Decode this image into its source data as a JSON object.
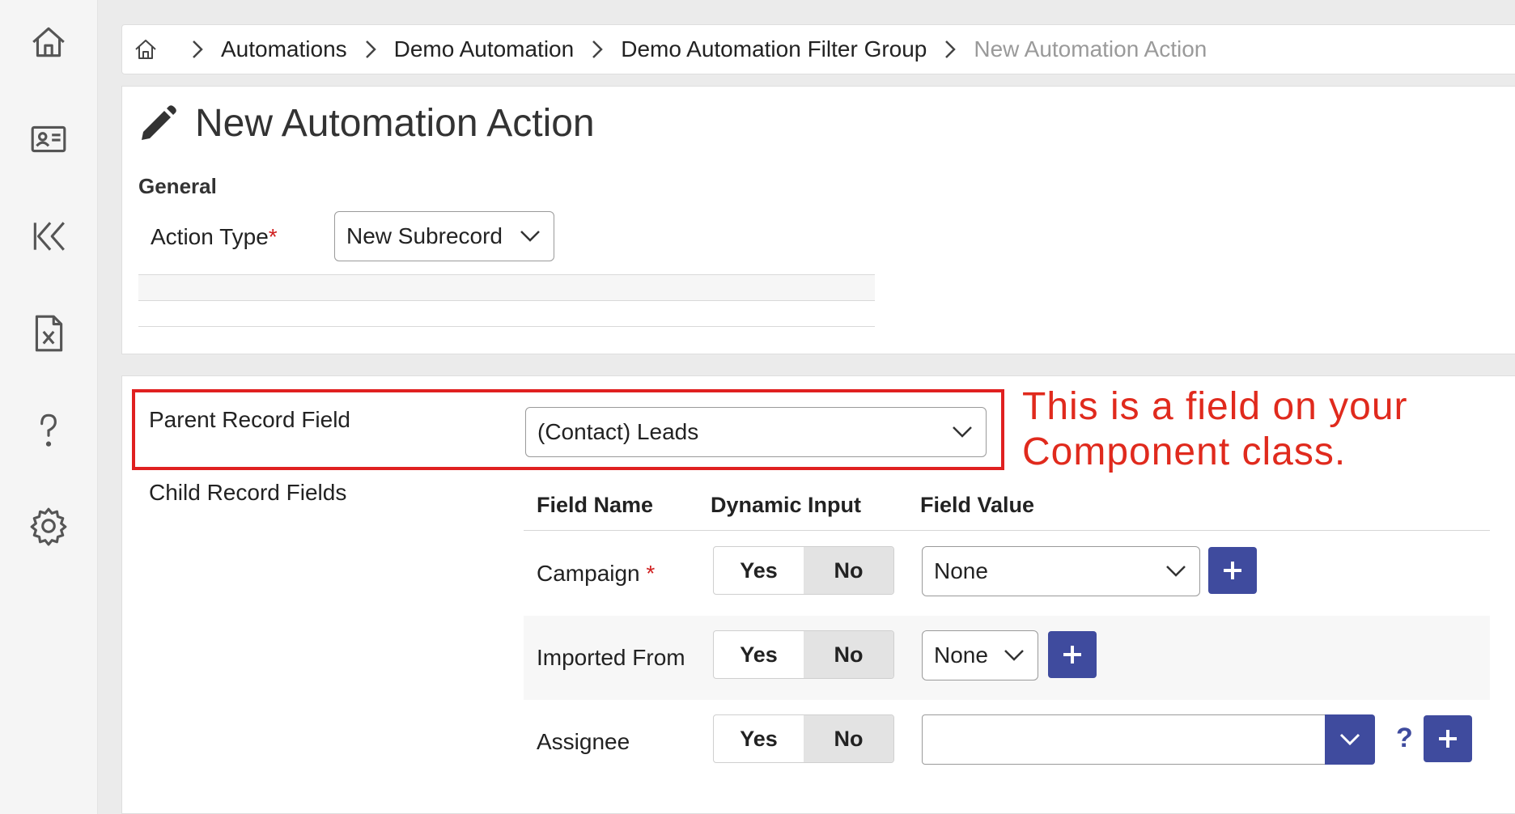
{
  "sidebar": {
    "items": [
      {
        "icon": "home-icon"
      },
      {
        "icon": "contact-card-icon"
      },
      {
        "icon": "rewind-icon"
      },
      {
        "icon": "excel-file-icon"
      },
      {
        "icon": "help-icon"
      },
      {
        "icon": "settings-gear-icon"
      }
    ]
  },
  "breadcrumb": {
    "home_icon": "home-icon",
    "items": [
      "Automations",
      "Demo Automation",
      "Demo Automation Filter Group"
    ],
    "current": "New Automation Action"
  },
  "form": {
    "title": "New Automation Action",
    "title_icon": "pencil-icon",
    "section_general": "General",
    "action_type_label": "Action Type",
    "required_mark": "*",
    "action_type_value": "New Subrecord"
  },
  "relationship": {
    "parent_record_field_label": "Parent Record Field",
    "parent_record_field_value": "(Contact) Leads",
    "child_record_fields_label": "Child Record Fields",
    "annotation_line1": "This is a field on your",
    "annotation_line2": "Component class.",
    "annotation_color": "#e02a1d"
  },
  "child_fields": {
    "columns": [
      "Field Name",
      "Dynamic Input",
      "Field Value"
    ],
    "yes_label": "Yes",
    "no_label": "No",
    "help_mark": "?",
    "rows": [
      {
        "name": "Campaign",
        "required": true,
        "dynamic": "No",
        "value": "None"
      },
      {
        "name": "Imported From",
        "required": false,
        "dynamic": "No",
        "value": "None"
      },
      {
        "name": "Assignee",
        "required": false,
        "dynamic": "No",
        "value": ""
      }
    ]
  },
  "colors": {
    "accent": "#3f4b9e",
    "required": "#d02020"
  }
}
